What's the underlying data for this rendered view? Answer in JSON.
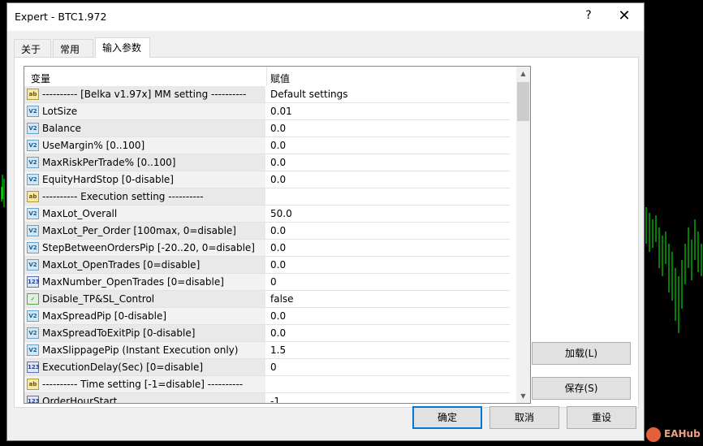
{
  "window": {
    "title": "Expert - BTC1.972",
    "help_symbol": "?",
    "close_symbol": "✕"
  },
  "tabs": [
    {
      "label": "关于",
      "active": false
    },
    {
      "label": "常用",
      "active": false
    },
    {
      "label": "输入参数",
      "active": true
    }
  ],
  "grid": {
    "headers": {
      "name": "变量",
      "value": "赋值"
    },
    "rows": [
      {
        "type": "ab",
        "name": "---------- [Belka v1.97x] MM setting ----------",
        "value": "Default settings"
      },
      {
        "type": "v2",
        "name": "LotSize",
        "value": "0.01"
      },
      {
        "type": "v2",
        "name": "Balance",
        "value": "0.0"
      },
      {
        "type": "v2",
        "name": "UseMargin% [0..100]",
        "value": "0.0"
      },
      {
        "type": "v2",
        "name": "MaxRiskPerTrade% [0..100]",
        "value": "0.0"
      },
      {
        "type": "v2",
        "name": "EquityHardStop [0-disable]",
        "value": "0.0"
      },
      {
        "type": "ab",
        "name": "---------- Execution setting ----------",
        "value": ""
      },
      {
        "type": "v2",
        "name": "MaxLot_Overall",
        "value": "50.0"
      },
      {
        "type": "v2",
        "name": "MaxLot_Per_Order [100max, 0=disable]",
        "value": "0.0"
      },
      {
        "type": "v2",
        "name": "StepBetweenOrdersPip [-20..20, 0=disable]",
        "value": "0.0"
      },
      {
        "type": "v2",
        "name": "MaxLot_OpenTrades [0=disable]",
        "value": "0.0"
      },
      {
        "type": "123",
        "name": "MaxNumber_OpenTrades [0=disable]",
        "value": "0"
      },
      {
        "type": "bool",
        "name": "Disable_TP&SL_Control",
        "value": "false"
      },
      {
        "type": "v2",
        "name": "MaxSpreadPip [0-disable]",
        "value": "0.0"
      },
      {
        "type": "v2",
        "name": "MaxSpreadToExitPip [0-disable]",
        "value": "0.0"
      },
      {
        "type": "v2",
        "name": "MaxSlippagePip (Instant Execution only)",
        "value": "1.5"
      },
      {
        "type": "123",
        "name": "ExecutionDelay(Sec) [0=disable]",
        "value": "0"
      },
      {
        "type": "ab",
        "name": "---------- Time setting [-1=disable] ----------",
        "value": ""
      },
      {
        "type": "123",
        "name": "OrderHourStart",
        "value": "-1"
      }
    ]
  },
  "icons": {
    "ab": "ab",
    "v2": "V2",
    "123": "123",
    "bool": "✓"
  },
  "buttons": {
    "load": "加载(L)",
    "save": "保存(S)",
    "ok": "确定",
    "cancel": "取消",
    "reset": "重设"
  },
  "watermark": {
    "text": "EAHub"
  },
  "colors": {
    "accent": "#0078d7",
    "chart_bg": "#000000",
    "candle": "#00ff00"
  }
}
